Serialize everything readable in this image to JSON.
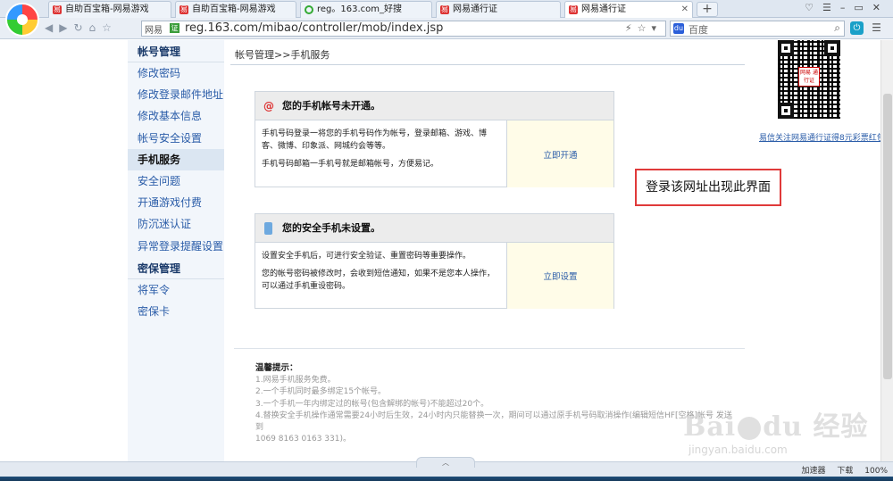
{
  "browser": {
    "tabs": [
      {
        "label": "自助百宝箱-网易游戏",
        "active": false
      },
      {
        "label": "自助百宝箱-网易游戏",
        "active": false
      },
      {
        "label": "reg。163.com_好搜",
        "active": false
      },
      {
        "label": "网易通行证",
        "active": false
      },
      {
        "label": "网易通行证",
        "active": true
      }
    ],
    "new_tab": "+",
    "address": {
      "net_label": "网易",
      "net_icon": "证",
      "url": "reg.163.com/mibao/controller/mob/index.jsp"
    },
    "search": {
      "placeholder": "百度"
    }
  },
  "sidebar": {
    "sections": [
      {
        "title": "帐号管理",
        "items": [
          "修改密码",
          "修改登录邮件地址",
          "修改基本信息",
          "帐号安全设置",
          "手机服务",
          "安全问题",
          "开通游戏付费",
          "防沉迷认证",
          "异常登录提醒设置"
        ]
      },
      {
        "title": "密保管理",
        "items": [
          "将军令",
          "密保卡"
        ]
      }
    ],
    "active_item": "手机服务"
  },
  "main": {
    "breadcrumb": "帐号管理>>手机服务",
    "box1": {
      "title": "您的手机帐号未开通。",
      "p1": "手机号码登录一将您的手机号码作为帐号，登录邮箱、游戏、博客、微博、印象派、网城约会等等。",
      "p2": "手机号码邮箱一手机号就是邮箱帐号，方便易记。",
      "action": "立即开通"
    },
    "box2": {
      "title": "您的安全手机未设置。",
      "p1": "设置安全手机后，可进行安全验证、重置密码等重要操作。",
      "p2": "您的帐号密码被修改时，会收到短信通知，如果不是您本人操作，可以通过手机重设密码。",
      "action": "立即设置"
    },
    "tips": {
      "title": "温馨提示：",
      "items": [
        "1.网易手机服务免费。",
        "2.一个手机同时最多绑定15个帐号。",
        "3.一个手机一年内绑定过的帐号(包含解绑的帐号)不能超过20个。",
        "4.替换安全手机操作通常需要24小时后生效，24小时内只能替换一次，期间可以通过原手机号码取消操作(编辑短信HF[空格]帐号 发送到",
        "1069 8163 0163 331)。"
      ]
    }
  },
  "right_panel": {
    "qr_center": "网易 通行证",
    "caption": "易信关注网易通行证得8元彩票红包"
  },
  "annotation": "登录该网址出现此界面",
  "watermark": {
    "logo_a": "Bai",
    "logo_b": "du",
    "logo_c": "经验",
    "sub": "jingyan.baidu.com"
  },
  "statusbar": {
    "accelerator": "加速器",
    "download": "下载",
    "zoom": "100%"
  }
}
